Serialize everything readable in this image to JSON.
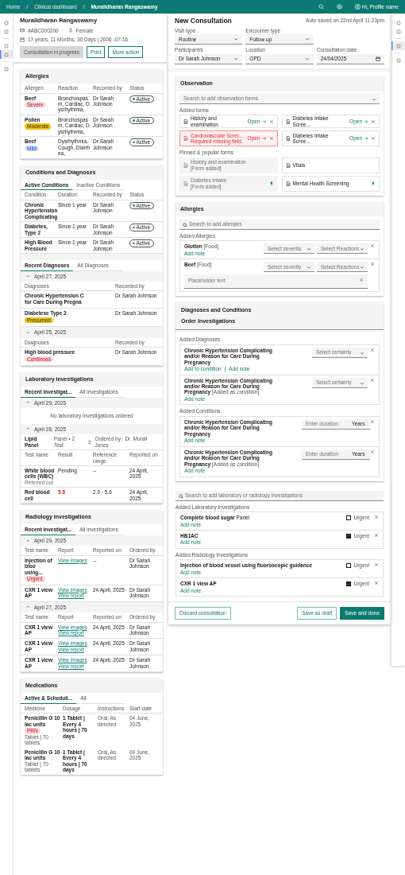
{
  "topbar": {
    "breadcrumbs": [
      {
        "label": "Home",
        "current": false
      },
      {
        "label": "Clinical dashboard",
        "current": false
      },
      {
        "label": "Muralidharan Rangaswamy",
        "current": true
      }
    ],
    "separator": "/",
    "profile": "Hi, Profile name"
  },
  "left_rail": [
    {
      "selected": false
    },
    {
      "selected": false
    },
    {
      "selected": false
    },
    {
      "selected": true
    },
    {
      "selected": false
    }
  ],
  "patient": {
    "name": "Muralidharan Rangaswamy",
    "id": "#ABC000200",
    "gender": "Female",
    "age": "17 years, 11 Months, 30 Days | 2006 -07-16",
    "buttons": [
      {
        "label": "Consultation in progress",
        "kind": "disabled"
      },
      {
        "label": "Print",
        "kind": "outline"
      },
      {
        "label": "More action",
        "kind": "outline"
      }
    ]
  },
  "allergies": {
    "title": "Allergies",
    "columns": [
      "Allergen",
      "Reaction",
      "Recorded by",
      "Status"
    ],
    "rows": [
      {
        "allergen": "Beef",
        "severity": {
          "label": "Severe",
          "color": "#ffd7d9"
        },
        "reaction": "Bronchospasm, Cardiac, Dysrhythmia,",
        "recorded_by": "Dr Sarah Johnson",
        "status": "Active"
      },
      {
        "allergen": "Pollen",
        "severity": {
          "label": "Moderate",
          "color": "#f1c21b"
        },
        "reaction": "Bronchospasm, Cardiac, Dysrhythmia,",
        "recorded_by": "Dr Sarah Johnson",
        "status": "Active"
      },
      {
        "allergen": "Beef",
        "severity": {
          "label": "Mild",
          "color": "#d0e2ff"
        },
        "reaction": "Dysrhythmia, Cough, Diarrhea,",
        "recorded_by": "Dr Sarah Johnson",
        "status": "Active"
      }
    ]
  },
  "conditions": {
    "title": "Conditions and Diagnoses",
    "tabs": [
      {
        "label": "Active Conditions",
        "selected": true
      },
      {
        "label": "Inactive Conditions",
        "selected": false
      }
    ],
    "columns": [
      "Condition",
      "Duration",
      "Recorded by",
      "Status"
    ],
    "rows": [
      {
        "condition": "Chronic Hypertension Complicating",
        "duration": "Since 1 year",
        "recorded_by": "Dr Sarah Johnson",
        "status": "Active"
      },
      {
        "condition": "Diabetes, Type 2",
        "duration": "Since 1 year",
        "recorded_by": "Dr Sarah Johnson",
        "status": "Active"
      },
      {
        "condition": "High Blood Pressure",
        "duration": "Since 1 year",
        "recorded_by": "Dr Sarah Johnson",
        "status": "Active"
      }
    ],
    "diagnosis_tabs": [
      {
        "label": "Recent Diagnoses",
        "selected": true
      },
      {
        "label": "All Diagnoses",
        "selected": false
      }
    ],
    "diagnosis_groups": [
      {
        "date": "April 27, 2025",
        "expanded": false,
        "columns": [
          "Diagnoses",
          "Recorded by"
        ],
        "rows": [
          {
            "diagnosis": "Chronic Hypertension C\nfor Care During Pregna",
            "recorded_by": "Dr Sarah Johnson"
          },
          {
            "diagnosis": "Diabetese Type 2",
            "tag": {
              "label": "Presumed",
              "color": "#f1c21b"
            },
            "recorded_by": "Dr Sarah Johnson"
          }
        ]
      },
      {
        "date": "April 25, 2025",
        "expanded": false,
        "columns": [
          "Diagnoses",
          "Recorded by"
        ],
        "rows": [
          {
            "diagnosis": "High blood pressure",
            "tag": {
              "label": "Confirmed",
              "color": "#ffd7d9"
            },
            "recorded_by": "Dr Sarah Johnson"
          }
        ]
      }
    ]
  },
  "laboratory": {
    "title": "Laboratory investigations",
    "tabs": [
      {
        "label": "Recent investigat...",
        "selected": true
      },
      {
        "label": "All investigations",
        "selected": false
      }
    ],
    "groups": [
      {
        "date": "April 29, 2025",
        "expanded": true,
        "message": "No laboratory investigations ordered"
      },
      {
        "date": "April 28, 2025",
        "expanded": true,
        "panel": {
          "name": "Lipid Panel",
          "meta": "Panel • 2 Test",
          "ordered_by": "Ordered by : Dr. Murali Jones"
        },
        "columns": [
          "Test name",
          "Result",
          "Reference range",
          "Reported on"
        ],
        "rows": [
          {
            "test": "White blood cells (WBC)",
            "note": "Referred out",
            "result": "Pending",
            "abnormal": false,
            "range": "--",
            "reported_on": "24 April, 2025"
          },
          {
            "test": "Red blood cell",
            "result": "5.8",
            "abnormal": true,
            "range": "2.0 - 5.6",
            "reported_on": "24 April, 2025"
          }
        ]
      }
    ]
  },
  "radiology": {
    "title": "Radiology investigations",
    "tabs": [
      {
        "label": "Recent investigat...",
        "selected": true
      },
      {
        "label": "All investigations",
        "selected": false
      }
    ],
    "groups": [
      {
        "date": "April 29, 2025",
        "expanded": true,
        "columns": [
          "Test name",
          "Report",
          "Reported on",
          "Ordered by"
        ],
        "rows": [
          {
            "test": "Injection of bloo\nusing...",
            "tag": {
              "label": "Urgent",
              "color": "#ffd7d9"
            },
            "links": [
              "View images"
            ],
            "reported_on": "--",
            "ordered_by": "Dr Sarah Johnson"
          },
          {
            "test": "CXR 1 view AP",
            "links": [
              "View images",
              "View report"
            ],
            "reported_on": "24 April, 2025",
            "ordered_by": "Dr Sarah Johnson"
          }
        ]
      },
      {
        "date": "April 27, 2025",
        "expanded": true,
        "columns": [
          "Test name",
          "Report",
          "Reported on",
          "Ordered by"
        ],
        "rows": [
          {
            "test": "CXR 1 view AP",
            "links": [
              "View images",
              "View report"
            ],
            "reported_on": "24 April, 2025",
            "ordered_by": "Dr Sarah Johnson"
          },
          {
            "test": "CXR 1 view AP",
            "links": [
              "View images",
              "View report"
            ],
            "reported_on": "24 April, 2025",
            "ordered_by": "Dr Sarah Johnson"
          },
          {
            "test": "CXR 1 view AP",
            "links": [
              "View images",
              "View report"
            ],
            "reported_on": "24 April, 2025",
            "ordered_by": "Dr Sarah Johnson"
          }
        ]
      }
    ]
  },
  "medications": {
    "title": "Medications",
    "tabs": [
      {
        "label": "Active & Scheduli...",
        "selected": true
      },
      {
        "label": "All",
        "selected": false
      }
    ],
    "columns": [
      "Medicine",
      "Dosage",
      "Instructions",
      "Start date"
    ],
    "rows": [
      {
        "medicine": "Penicillin G 10 lac units",
        "tag": {
          "label": "PRN",
          "color": "#ffd7d9"
        },
        "form": "Tablet | 70 tablets",
        "dosage": "1 Tablet | Every 4 hours | 70 days",
        "instructions": "Oral, As directed",
        "start_date": "04 June, 2025"
      },
      {
        "medicine": "Penicillin G 10 lac units",
        "form": "Tablet | 70 tablets",
        "dosage": "1 Tablet | Every 4 hours | 70 days",
        "instructions": "Oral, As directed",
        "start_date": "04 June, 2025"
      }
    ]
  },
  "consultation": {
    "title": "New Consultation",
    "autosave": "Auto saved on 22nd April 11:23pm",
    "field_rows": [
      [
        {
          "label": "Visit type",
          "value": "Routine",
          "kind": "select"
        },
        {
          "label": "Encounter type",
          "value": "Follow up",
          "kind": "select"
        }
      ],
      [
        {
          "label": "Participant/s",
          "value": "Dr Sarah Johnson",
          "kind": "select"
        },
        {
          "label": "Location",
          "value": "OPD",
          "kind": "select"
        },
        {
          "label": "Consultation date",
          "value": "24/04/2025",
          "kind": "date"
        }
      ]
    ]
  },
  "observation": {
    "title": "Observation",
    "search_placeholder": "Search to add observation forms",
    "added_label": "Added forms",
    "added_forms": [
      {
        "name": "History and examination",
        "action": "Open",
        "error": false
      },
      {
        "name": "Diabetes Intake Scree...",
        "action": "Open",
        "error": false
      },
      {
        "name": "Cardiovascular Screi...",
        "action": "Open",
        "error": true,
        "error_text": "Required missing field"
      },
      {
        "name": "Diabetes Intake Scree...",
        "action": "Open",
        "error": false
      }
    ],
    "pinned_label": "Pinned & popular forms",
    "pinned_forms": [
      {
        "name": "History and examination",
        "status": "[Form added]",
        "added": true,
        "pinned": false
      },
      {
        "name": "Vitals",
        "added": false,
        "pinned": false
      },
      {
        "name": "Diabetes Intake",
        "status": "[Form added]",
        "added": true,
        "pinned": true
      },
      {
        "name": "Mental Health Screening",
        "added": false,
        "pinned": true
      }
    ]
  },
  "allergy_entry": {
    "title": "Allergies",
    "search_placeholder": "Search to add allergies",
    "added_label": "Added Allergies",
    "items": [
      {
        "name": "Glutten",
        "category": "[Food]",
        "severity_placeholder": "Select severity",
        "reactions_placeholder": "Select Reactions",
        "note_link": "Add note"
      },
      {
        "name": "Beef",
        "category": "[Food]",
        "severity_placeholder": "Select severity",
        "reactions_placeholder": "Select Reactions",
        "note_placeholder": "Placeholder text"
      }
    ]
  },
  "diagnoses_entry": {
    "titles": [
      "Diagnoses and Conditions",
      "Order Investigations"
    ],
    "diagnoses_label": "Added Diagnoses",
    "link_separator": "|",
    "diagnoses": [
      {
        "name": "Chronic Hypertension Complicating and/or Reason for Care During Pregnancy",
        "certainty_placeholder": "Select certainty",
        "links": [
          "Add to condition",
          "Add note"
        ]
      },
      {
        "name": "Chronic Hypertension Complicating and/or Reason for Care During Pregnancy",
        "suffix": "[Added as condition]",
        "certainty_placeholder": "Select certainty",
        "links": [
          "Add note"
        ]
      }
    ],
    "conditions_label": "Added Conditions",
    "conditions": [
      {
        "name": "Chronic Hypertension Complicating and/or Reason for Care During Pregnancy",
        "duration_placeholder": "Enter duration",
        "unit": "Years",
        "links": [
          "Add note"
        ]
      },
      {
        "name": "Chronic Hypertension Complicating and/or Reason for Care During Pregnancy",
        "suffix": "[Added as condition]",
        "duration_placeholder": "Enter duration",
        "unit": "Years",
        "links": [
          "Add note"
        ]
      }
    ]
  },
  "investigations": {
    "search_placeholder": "Search to add laboratory or radiology investigations",
    "lab_label": "Added Laboratory Investigations",
    "lab": [
      {
        "name": "Complete blood sugar",
        "suffix": "Panel",
        "urgent": false,
        "urgent_label": "Urgent",
        "note_link": "Add note"
      },
      {
        "name": "HB1AC",
        "urgent": true,
        "urgent_label": "Urgent",
        "note_link": "Add note"
      }
    ],
    "radiology_label": "Added Radiology Investigations",
    "radiology": [
      {
        "name": "Injection of blood vessel using fluoroscopic guidance",
        "urgent": false,
        "urgent_label": "Urgent",
        "note_link": "Add note"
      },
      {
        "name": "CXR 1 view AP",
        "urgent": true,
        "urgent_label": "Urgent",
        "note_link": "Add note"
      }
    ]
  },
  "footer": {
    "buttons": [
      {
        "label": "Discard consultation",
        "kind": "outline"
      },
      {
        "label": "Save as draft",
        "kind": "outline"
      },
      {
        "label": "Save and done",
        "kind": "primary"
      }
    ]
  },
  "right_rail": [
    {
      "selected": false
    },
    {
      "selected": false
    },
    {
      "selected": true
    },
    {
      "selected": false
    }
  ]
}
